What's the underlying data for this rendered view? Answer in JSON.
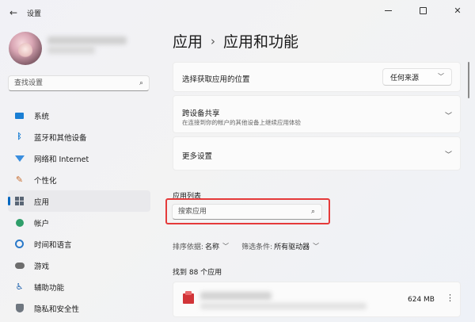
{
  "window": {
    "title": "设置"
  },
  "sidebar": {
    "search_placeholder": "查找设置",
    "items": [
      {
        "label": "系统",
        "icon": "system-icon"
      },
      {
        "label": "蓝牙和其他设备",
        "icon": "bluetooth-icon"
      },
      {
        "label": "网络和 Internet",
        "icon": "network-icon"
      },
      {
        "label": "个性化",
        "icon": "personalization-icon"
      },
      {
        "label": "应用",
        "icon": "apps-icon",
        "active": true
      },
      {
        "label": "帐户",
        "icon": "account-icon"
      },
      {
        "label": "时间和语言",
        "icon": "time-language-icon"
      },
      {
        "label": "游戏",
        "icon": "gaming-icon"
      },
      {
        "label": "辅助功能",
        "icon": "accessibility-icon"
      },
      {
        "label": "隐私和安全性",
        "icon": "privacy-icon"
      }
    ]
  },
  "main": {
    "breadcrumb": {
      "parent": "应用",
      "separator": "›",
      "current": "应用和功能"
    },
    "cards": {
      "install_source": {
        "title": "选择获取应用的位置",
        "value": "任何来源"
      },
      "share": {
        "title": "跨设备共享",
        "subtitle": "在连接到你的帐户的其他设备上继续应用体验"
      },
      "more": {
        "title": "更多设置"
      }
    },
    "app_list": {
      "label": "应用列表",
      "search_placeholder": "搜索应用",
      "sort_label": "排序依据:",
      "sort_value": "名称",
      "filter_label": "筛选条件:",
      "filter_value": "所有驱动器",
      "found_text": "找到 88 个应用",
      "first_app_size": "624 MB"
    }
  },
  "colors": {
    "accent": "#0067c0",
    "highlight": "#e53a3a"
  }
}
